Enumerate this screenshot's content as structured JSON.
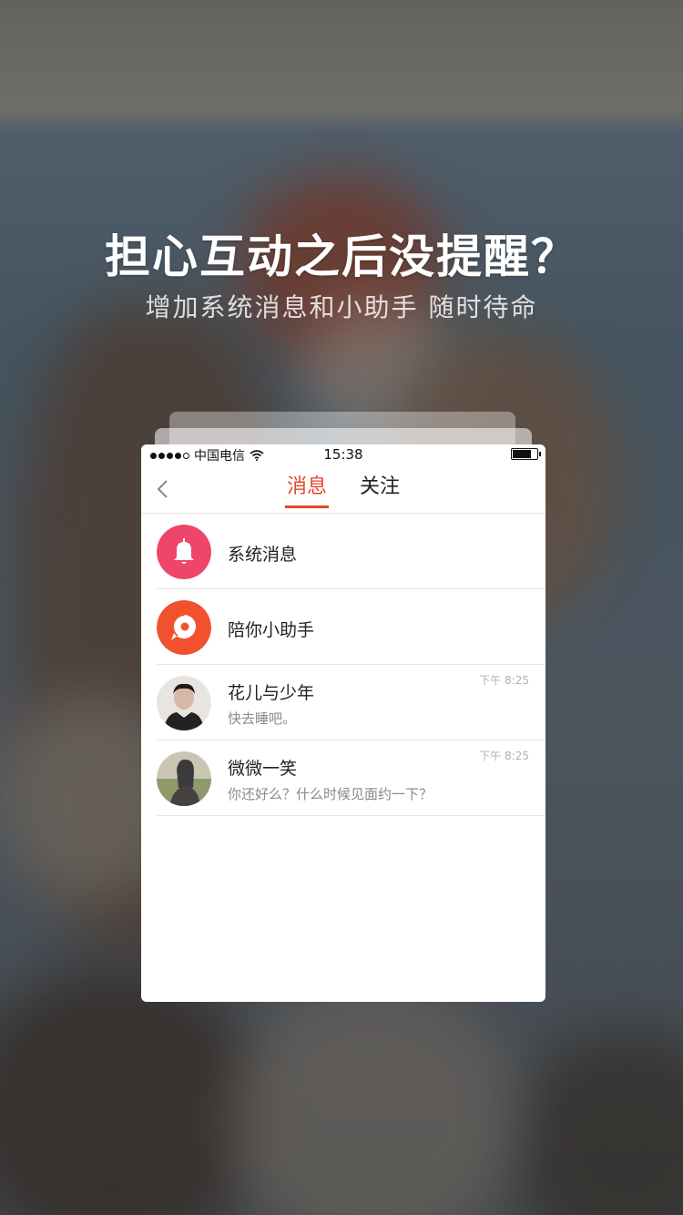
{
  "banner": {
    "headline": "担心互动之后没提醒？",
    "subline": "增加系统消息和小助手  随时待命"
  },
  "status_bar": {
    "carrier": "中国电信",
    "time": "15:38"
  },
  "nav": {
    "tabs": [
      {
        "label": "消息",
        "active": true
      },
      {
        "label": "关注",
        "active": false
      }
    ]
  },
  "messages": [
    {
      "name": "系统消息",
      "avatar": "bell-icon",
      "color": "#f0456a"
    },
    {
      "name": "陪你小助手",
      "avatar": "assistant-icon",
      "color": "#f2512e"
    },
    {
      "name": "花儿与少年",
      "preview": "快去睡吧。",
      "time": "下午 8:25",
      "avatar": "user-photo"
    },
    {
      "name": "微微一笑",
      "preview": "你还好么？什么时候见面约一下？",
      "time": "下午 8:25",
      "avatar": "user-photo"
    }
  ],
  "colors": {
    "accent": "#e8452a"
  }
}
